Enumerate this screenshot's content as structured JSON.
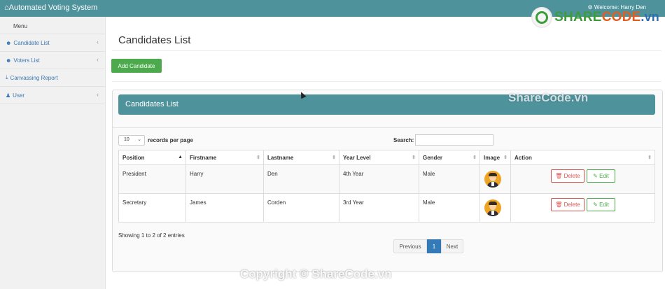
{
  "navbar": {
    "brand": "Automated Voting System",
    "welcome": "Welcome: Harry Den"
  },
  "watermark_logo": {
    "share": "SHARE",
    "code": "CODE",
    "vn": ".vn"
  },
  "sidebar": {
    "menu_label": "Menu",
    "items": [
      {
        "label": "Candidate List",
        "icon": "users-icon",
        "has_chevron": true
      },
      {
        "label": "Voters List",
        "icon": "users-icon",
        "has_chevron": true
      },
      {
        "label": "Canvassing Report",
        "icon": "download-icon",
        "has_chevron": false
      },
      {
        "label": "User",
        "icon": "user-icon",
        "has_chevron": true
      }
    ]
  },
  "main": {
    "page_title": "Candidates List",
    "add_button": "Add Candidate",
    "panel_title": "Candidates List",
    "length_value": "10",
    "length_label": "records per page",
    "search_label": "Search:",
    "search_value": "",
    "columns": [
      "Position",
      "Firstname",
      "Lastname",
      "Year Level",
      "Gender",
      "Image",
      "Action"
    ],
    "rows": [
      {
        "position": "President",
        "firstname": "Harry",
        "lastname": "Den",
        "year_level": "4th Year",
        "gender": "Male"
      },
      {
        "position": "Secretary",
        "firstname": "James",
        "lastname": "Corden",
        "year_level": "3rd Year",
        "gender": "Male"
      }
    ],
    "delete_label": "Delete",
    "edit_label": "Edit",
    "info": "Showing 1 to 2 of 2 entries",
    "pagination": {
      "prev": "Previous",
      "current": "1",
      "next": "Next"
    }
  },
  "watermarks": {
    "mid": "ShareCode.vn",
    "bottom": "Copyright © ShareCode.vn"
  },
  "colors": {
    "navbar": "#4e929c",
    "add_button": "#4ca94c",
    "delete": "#d9534f",
    "edit": "#4ca94c",
    "page_active": "#337ab7"
  }
}
